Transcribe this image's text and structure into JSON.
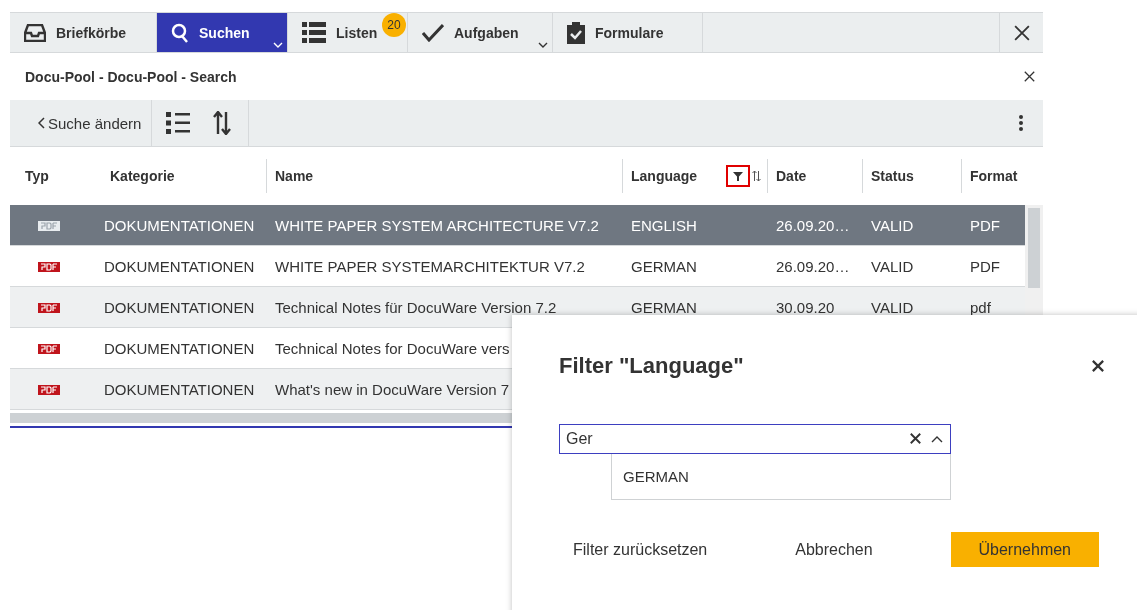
{
  "tabs": [
    {
      "label": "Briefkörbe",
      "kind": "tray",
      "selected": false
    },
    {
      "label": "Suchen",
      "kind": "search",
      "selected": true,
      "caret": true
    },
    {
      "label": "Listen",
      "kind": "list",
      "selected": false,
      "badge": "20"
    },
    {
      "label": "Aufgaben",
      "kind": "check",
      "selected": false,
      "caret": true
    },
    {
      "label": "Formulare",
      "kind": "clipboard",
      "selected": false
    }
  ],
  "panel": {
    "title": "Docu-Pool - Docu-Pool - Search"
  },
  "toolbar": {
    "back_label": "Suche ändern"
  },
  "table": {
    "columns": [
      {
        "label": "Typ",
        "filtered": false
      },
      {
        "label": "Kategorie",
        "filtered": false
      },
      {
        "label": "Name",
        "filtered": false
      },
      {
        "label": "Language",
        "filtered": true
      },
      {
        "label": "Date",
        "filtered": false
      },
      {
        "label": "Status",
        "filtered": false
      },
      {
        "label": "Format",
        "filtered": false
      }
    ],
    "rows": [
      {
        "selected": true,
        "cells": [
          "",
          "DOKUMENTATIONEN",
          "WHITE PAPER SYSTEM ARCHITECTURE V7.2",
          "ENGLISH",
          "26.09.20…",
          "VALID",
          "PDF"
        ]
      },
      {
        "selected": false,
        "cells": [
          "",
          "DOKUMENTATIONEN",
          "WHITE PAPER SYSTEMARCHITEKTUR V7.2",
          "GERMAN",
          "26.09.20…",
          "VALID",
          "PDF"
        ]
      },
      {
        "selected": false,
        "cells": [
          "",
          "DOKUMENTATIONEN",
          "Technical Notes für DocuWare Version 7.2",
          "GERMAN",
          "30.09.20",
          "VALID",
          "pdf"
        ]
      },
      {
        "selected": false,
        "cells": [
          "",
          "DOKUMENTATIONEN",
          "Technical Notes for DocuWare vers"
        ]
      },
      {
        "selected": false,
        "cells": [
          "",
          "DOKUMENTATIONEN",
          "What's new in DocuWare Version 7"
        ]
      }
    ]
  },
  "dialog": {
    "title": "Filter \"Language\"",
    "field_value": "Ger",
    "suggestions": [
      "GERMAN"
    ],
    "buttons": [
      {
        "label": "Filter zurücksetzen",
        "kind": "plain"
      },
      {
        "label": "Abbrechen",
        "kind": "plain"
      },
      {
        "label": "Übernehmen",
        "kind": "primary"
      }
    ]
  }
}
